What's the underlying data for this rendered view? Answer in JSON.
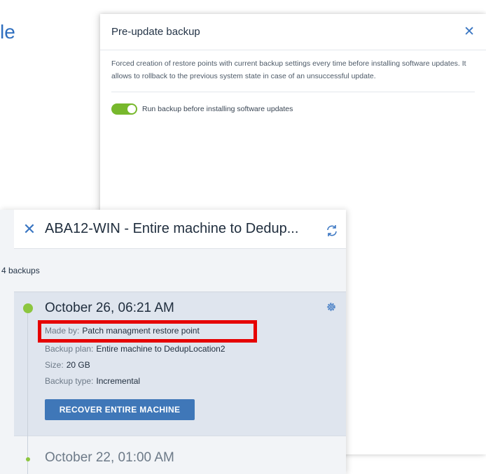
{
  "background": {
    "fragment_text": "le"
  },
  "pre_update_panel": {
    "title": "Pre-update backup",
    "close_icon": "close-icon",
    "description": "Forced creation of restore points with current backup settings every time before installing software updates. It allows to rollback to the previous system state in case of an unsuccessful update.",
    "toggle": {
      "label": "Run backup before installing software updates",
      "state": "on",
      "color": "#77b82c"
    }
  },
  "backup_panel": {
    "close_icon": "close-icon",
    "title": "ABA12-WIN - Entire machine to Dedup...",
    "count_label": "4 backups",
    "refresh_icon": "refresh-icon",
    "selected_entry": {
      "date": "October 26, 06:21 AM",
      "settings_icon": "gear-icon",
      "made_by_key": "Made by:",
      "made_by_value": "Patch managment restore point",
      "plan_key": "Backup plan:",
      "plan_value": "Entire machine to DedupLocation2",
      "size_key": "Size:",
      "size_value": "20 GB",
      "type_key": "Backup type:",
      "type_value": "Incremental",
      "recover_button": "RECOVER ENTIRE MACHINE"
    },
    "next_entry": {
      "date": "October 22, 01:00 AM"
    },
    "colors": {
      "accent": "#3f77b8",
      "status_dot": "#8cc63f",
      "highlight": "#e60000"
    }
  }
}
